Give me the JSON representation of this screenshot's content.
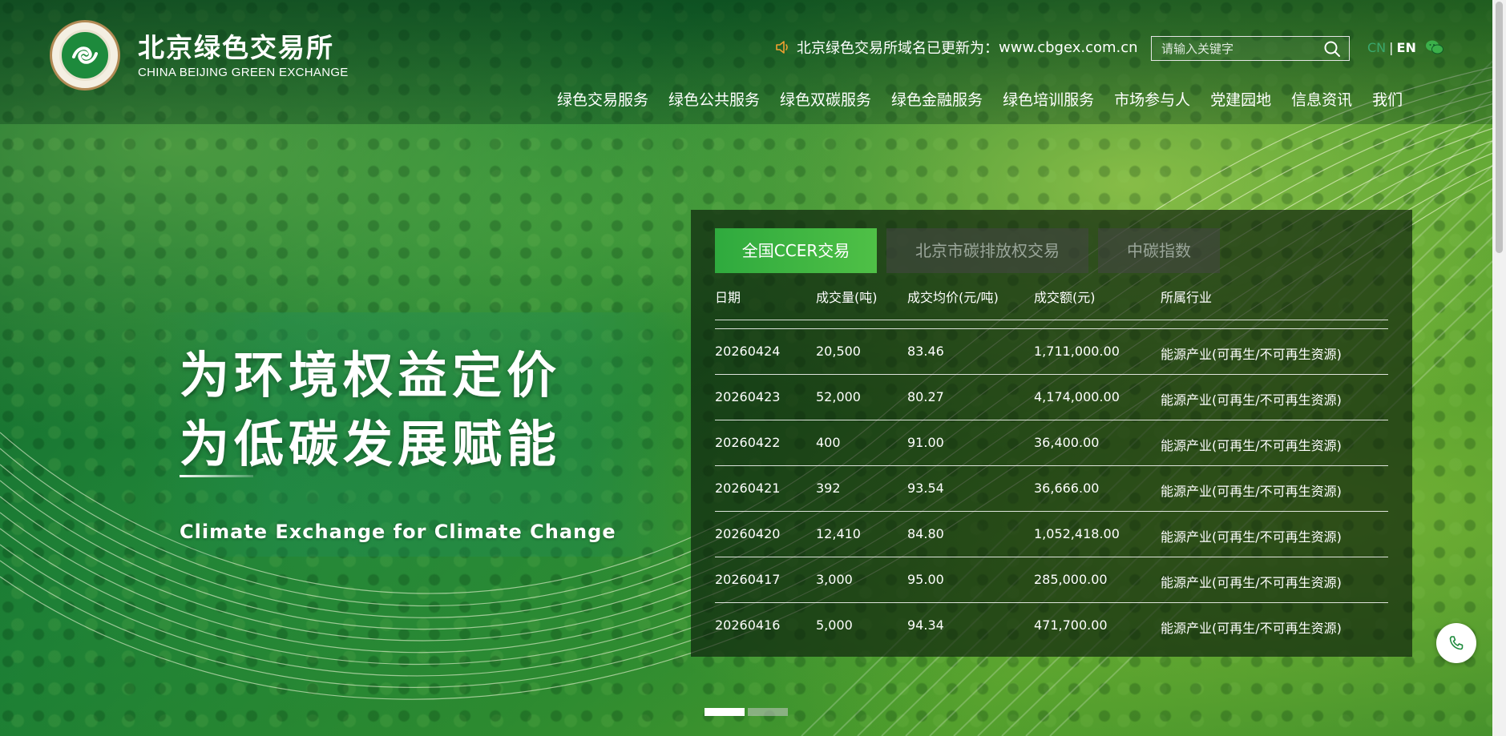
{
  "header": {
    "logo_cn": "北京绿色交易所",
    "logo_en": "CHINA BEIJING GREEN EXCHANGE",
    "notice_text": "北京绿色交易所域名已更新为：",
    "notice_domain": "www.cbgex.com.cn",
    "search_placeholder": "请输入关键字",
    "lang_cn": "CN",
    "lang_sep": "|",
    "lang_en": "EN"
  },
  "nav": {
    "items": [
      "绿色交易服务",
      "绿色公共服务",
      "绿色双碳服务",
      "绿色金融服务",
      "绿色培训服务",
      "市场参与人",
      "党建园地",
      "信息资讯",
      "我们"
    ]
  },
  "hero": {
    "slogan_line1": "为环境权益定价",
    "slogan_line2": "为低碳发展赋能",
    "slogan_en": "Climate Exchange for Climate Change"
  },
  "trading": {
    "tabs": [
      "全国CCER交易",
      "北京市碳排放权交易",
      "中碳指数"
    ],
    "active_tab": 0,
    "columns": [
      "日期",
      "成交量(吨)",
      "成交均价(元/吨)",
      "成交额(元)",
      "所属行业"
    ],
    "rows": [
      [
        "20260424",
        "20,500",
        "83.46",
        "1,711,000.00",
        "能源产业(可再生/不可再生资源)"
      ],
      [
        "20260423",
        "52,000",
        "80.27",
        "4,174,000.00",
        "能源产业(可再生/不可再生资源)"
      ],
      [
        "20260422",
        "400",
        "91.00",
        "36,400.00",
        "能源产业(可再生/不可再生资源)"
      ],
      [
        "20260421",
        "392",
        "93.54",
        "36,666.00",
        "能源产业(可再生/不可再生资源)"
      ],
      [
        "20260420",
        "12,410",
        "84.80",
        "1,052,418.00",
        "能源产业(可再生/不可再生资源)"
      ],
      [
        "20260417",
        "3,000",
        "95.00",
        "285,000.00",
        "能源产业(可再生/不可再生资源)"
      ],
      [
        "20260416",
        "5,000",
        "94.34",
        "471,700.00",
        "能源产业(可再生/不可再生资源)"
      ]
    ]
  },
  "carousel": {
    "slide_count": 2,
    "active_slide": 0
  },
  "colors": {
    "accent_green": "#2faa3e",
    "lang_active": "#3aa86d"
  },
  "icons": [
    "logo-emblem-icon",
    "speaker-icon",
    "search-icon",
    "wechat-icon",
    "phone-icon"
  ]
}
